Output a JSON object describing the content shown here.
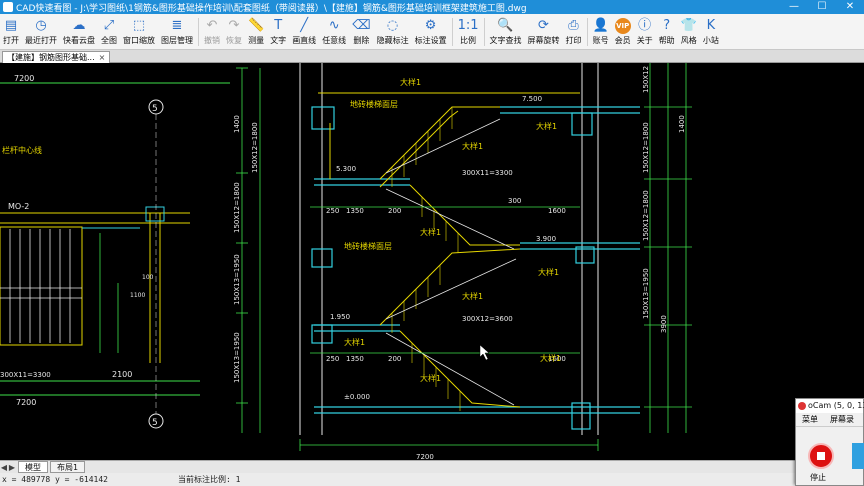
{
  "titlebar": {
    "title": "CAD快速看图 - J:\\学习图纸\\1钢筋&图形基础操作培训\\配套图纸（带阅读器）\\【建施】钢筋&图形基础培训框架建筑施工图.dwg",
    "minimize_icon": "minimize-icon",
    "maximize_icon": "maximize-icon",
    "close_icon": "close-icon"
  },
  "toolbar": {
    "items": [
      {
        "label": "打开",
        "icon": "folder-icon",
        "glyph": "▤"
      },
      {
        "label": "最近打开",
        "icon": "recent-icon",
        "glyph": "◷"
      },
      {
        "label": "快看云盘",
        "icon": "cloud-icon",
        "glyph": "☁"
      },
      {
        "label": "全图",
        "icon": "fullview-icon",
        "glyph": "⤢"
      },
      {
        "label": "窗口缩放",
        "icon": "zoom-window-icon",
        "glyph": "⬚"
      },
      {
        "label": "图层管理",
        "icon": "layers-icon",
        "glyph": "≣"
      },
      {
        "label": "撤销",
        "icon": "undo-icon",
        "glyph": "↶"
      },
      {
        "label": "恢复",
        "icon": "redo-icon",
        "glyph": "↷"
      },
      {
        "label": "测量",
        "icon": "measure-icon",
        "glyph": "📏"
      },
      {
        "label": "文字",
        "icon": "text-icon",
        "glyph": "T"
      },
      {
        "label": "画直线",
        "icon": "line-icon",
        "glyph": "╱"
      },
      {
        "label": "任意线",
        "icon": "freeline-icon",
        "glyph": "∿"
      },
      {
        "label": "删除",
        "icon": "delete-icon",
        "glyph": "⌫"
      },
      {
        "label": "隐藏标注",
        "icon": "hide-annotation-icon",
        "glyph": "◌"
      },
      {
        "label": "标注设置",
        "icon": "annotation-settings-icon",
        "glyph": "⚙"
      },
      {
        "label": "比例",
        "icon": "scale-icon",
        "glyph": "1:1"
      },
      {
        "label": "文字查找",
        "icon": "text-search-icon",
        "glyph": "🔍"
      },
      {
        "label": "屏幕旋转",
        "icon": "rotate-screen-icon",
        "glyph": "⟳"
      },
      {
        "label": "打印",
        "icon": "print-icon",
        "glyph": "⎙"
      },
      {
        "label": "账号",
        "icon": "account-icon",
        "glyph": "👤"
      },
      {
        "label": "会员",
        "icon": "vip-icon",
        "glyph": "VIP"
      },
      {
        "label": "关于",
        "icon": "about-icon",
        "glyph": "ⓘ"
      },
      {
        "label": "帮助",
        "icon": "help-icon",
        "glyph": "?"
      },
      {
        "label": "风格",
        "icon": "style-icon",
        "glyph": "👕"
      },
      {
        "label": "小站",
        "icon": "station-icon",
        "glyph": "K"
      }
    ]
  },
  "document_tab": {
    "label": "【建施】钢筋图形基础..."
  },
  "drawing": {
    "dims": {
      "top_left": "7200",
      "left_bottom_1": "7200",
      "left_mid_1": "7200",
      "left_dim_3300": "300X11=3300",
      "left_dim_2100": "2100",
      "mo2": "MO-2",
      "stair_note": "栏杆中心线",
      "left_v_1": "1450",
      "left_v_2": "1450",
      "left_v_3": "100",
      "left_v_4": "1100",
      "bottom_7200": "7200",
      "axis_5_top": "5",
      "axis_5_bottom": "5",
      "v_1400": "1400",
      "v_150x12": "150X12=1800",
      "v_150x12b": "150X12=1800",
      "v_150x13": "150X13=1950",
      "v_150x13b": "150X13=1950",
      "v_3900": "3900",
      "v_150x13_right": "150X13=1950",
      "v_150x12_right": "150X12=1800",
      "v_150x12_right2": "150X12=1800",
      "v_1400_right": "1400",
      "top_right_v": "150X12",
      "lvl_7500": "7.500",
      "lvl_5300": "5.300",
      "lvl_3900": "3.900",
      "lvl_1950": "1.950",
      "lvl_000": "±0.000",
      "tread_1": "300X11=3300",
      "tread_2": "300X12=3600",
      "dim_250": "250",
      "dim_1350": "1350",
      "dim_200": "200",
      "dim_1600": "1600",
      "dim_300": "300",
      "dim_250b": "250",
      "dim_1350b": "1350",
      "dim_200b": "200",
      "dim_1600b": "1600",
      "floor_label_1": "地砖楼梯面层",
      "floor_label_2": "地砖楼梯面层",
      "stair_tag_1": "大样1",
      "stair_tag_2": "大样1",
      "stair_tag_3": "大样1",
      "stair_tag_4": "大样1",
      "stair_tag_5": "大样1",
      "stair_tag_6": "大样1",
      "stair_tag_7": "大样1",
      "stair_tag_8": "大样1",
      "stair_tag_9": "大样1"
    }
  },
  "layout_tabs": {
    "items": [
      "模型",
      "布局1"
    ]
  },
  "status": {
    "coords": "x = 489778 y = -614142",
    "scale": "当前标注比例: 1"
  },
  "ocam": {
    "title": "oCam (5, 0, 136",
    "menu_1": "菜单",
    "menu_2": "屏幕录",
    "stop_label": "停止"
  },
  "colors": {
    "title_blue": "#1f8ed8",
    "cad_yellow": "#e5d600",
    "cad_green": "#3ee04a",
    "cad_cyan": "#33d0e0",
    "cad_white": "#e8e8e8"
  }
}
